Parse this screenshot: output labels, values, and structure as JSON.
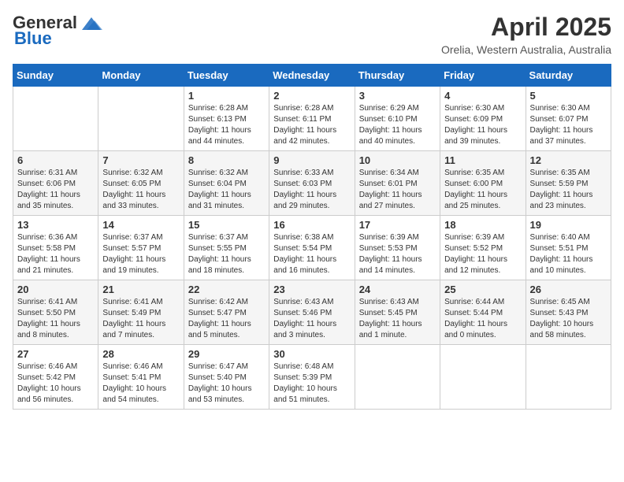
{
  "header": {
    "logo_line1": "General",
    "logo_line2": "Blue",
    "month": "April 2025",
    "location": "Orelia, Western Australia, Australia"
  },
  "days_of_week": [
    "Sunday",
    "Monday",
    "Tuesday",
    "Wednesday",
    "Thursday",
    "Friday",
    "Saturday"
  ],
  "weeks": [
    [
      {
        "day": "",
        "sunrise": "",
        "sunset": "",
        "daylight": ""
      },
      {
        "day": "",
        "sunrise": "",
        "sunset": "",
        "daylight": ""
      },
      {
        "day": "1",
        "sunrise": "Sunrise: 6:28 AM",
        "sunset": "Sunset: 6:13 PM",
        "daylight": "Daylight: 11 hours and 44 minutes."
      },
      {
        "day": "2",
        "sunrise": "Sunrise: 6:28 AM",
        "sunset": "Sunset: 6:11 PM",
        "daylight": "Daylight: 11 hours and 42 minutes."
      },
      {
        "day": "3",
        "sunrise": "Sunrise: 6:29 AM",
        "sunset": "Sunset: 6:10 PM",
        "daylight": "Daylight: 11 hours and 40 minutes."
      },
      {
        "day": "4",
        "sunrise": "Sunrise: 6:30 AM",
        "sunset": "Sunset: 6:09 PM",
        "daylight": "Daylight: 11 hours and 39 minutes."
      },
      {
        "day": "5",
        "sunrise": "Sunrise: 6:30 AM",
        "sunset": "Sunset: 6:07 PM",
        "daylight": "Daylight: 11 hours and 37 minutes."
      }
    ],
    [
      {
        "day": "6",
        "sunrise": "Sunrise: 6:31 AM",
        "sunset": "Sunset: 6:06 PM",
        "daylight": "Daylight: 11 hours and 35 minutes."
      },
      {
        "day": "7",
        "sunrise": "Sunrise: 6:32 AM",
        "sunset": "Sunset: 6:05 PM",
        "daylight": "Daylight: 11 hours and 33 minutes."
      },
      {
        "day": "8",
        "sunrise": "Sunrise: 6:32 AM",
        "sunset": "Sunset: 6:04 PM",
        "daylight": "Daylight: 11 hours and 31 minutes."
      },
      {
        "day": "9",
        "sunrise": "Sunrise: 6:33 AM",
        "sunset": "Sunset: 6:03 PM",
        "daylight": "Daylight: 11 hours and 29 minutes."
      },
      {
        "day": "10",
        "sunrise": "Sunrise: 6:34 AM",
        "sunset": "Sunset: 6:01 PM",
        "daylight": "Daylight: 11 hours and 27 minutes."
      },
      {
        "day": "11",
        "sunrise": "Sunrise: 6:35 AM",
        "sunset": "Sunset: 6:00 PM",
        "daylight": "Daylight: 11 hours and 25 minutes."
      },
      {
        "day": "12",
        "sunrise": "Sunrise: 6:35 AM",
        "sunset": "Sunset: 5:59 PM",
        "daylight": "Daylight: 11 hours and 23 minutes."
      }
    ],
    [
      {
        "day": "13",
        "sunrise": "Sunrise: 6:36 AM",
        "sunset": "Sunset: 5:58 PM",
        "daylight": "Daylight: 11 hours and 21 minutes."
      },
      {
        "day": "14",
        "sunrise": "Sunrise: 6:37 AM",
        "sunset": "Sunset: 5:57 PM",
        "daylight": "Daylight: 11 hours and 19 minutes."
      },
      {
        "day": "15",
        "sunrise": "Sunrise: 6:37 AM",
        "sunset": "Sunset: 5:55 PM",
        "daylight": "Daylight: 11 hours and 18 minutes."
      },
      {
        "day": "16",
        "sunrise": "Sunrise: 6:38 AM",
        "sunset": "Sunset: 5:54 PM",
        "daylight": "Daylight: 11 hours and 16 minutes."
      },
      {
        "day": "17",
        "sunrise": "Sunrise: 6:39 AM",
        "sunset": "Sunset: 5:53 PM",
        "daylight": "Daylight: 11 hours and 14 minutes."
      },
      {
        "day": "18",
        "sunrise": "Sunrise: 6:39 AM",
        "sunset": "Sunset: 5:52 PM",
        "daylight": "Daylight: 11 hours and 12 minutes."
      },
      {
        "day": "19",
        "sunrise": "Sunrise: 6:40 AM",
        "sunset": "Sunset: 5:51 PM",
        "daylight": "Daylight: 11 hours and 10 minutes."
      }
    ],
    [
      {
        "day": "20",
        "sunrise": "Sunrise: 6:41 AM",
        "sunset": "Sunset: 5:50 PM",
        "daylight": "Daylight: 11 hours and 8 minutes."
      },
      {
        "day": "21",
        "sunrise": "Sunrise: 6:41 AM",
        "sunset": "Sunset: 5:49 PM",
        "daylight": "Daylight: 11 hours and 7 minutes."
      },
      {
        "day": "22",
        "sunrise": "Sunrise: 6:42 AM",
        "sunset": "Sunset: 5:47 PM",
        "daylight": "Daylight: 11 hours and 5 minutes."
      },
      {
        "day": "23",
        "sunrise": "Sunrise: 6:43 AM",
        "sunset": "Sunset: 5:46 PM",
        "daylight": "Daylight: 11 hours and 3 minutes."
      },
      {
        "day": "24",
        "sunrise": "Sunrise: 6:43 AM",
        "sunset": "Sunset: 5:45 PM",
        "daylight": "Daylight: 11 hours and 1 minute."
      },
      {
        "day": "25",
        "sunrise": "Sunrise: 6:44 AM",
        "sunset": "Sunset: 5:44 PM",
        "daylight": "Daylight: 11 hours and 0 minutes."
      },
      {
        "day": "26",
        "sunrise": "Sunrise: 6:45 AM",
        "sunset": "Sunset: 5:43 PM",
        "daylight": "Daylight: 10 hours and 58 minutes."
      }
    ],
    [
      {
        "day": "27",
        "sunrise": "Sunrise: 6:46 AM",
        "sunset": "Sunset: 5:42 PM",
        "daylight": "Daylight: 10 hours and 56 minutes."
      },
      {
        "day": "28",
        "sunrise": "Sunrise: 6:46 AM",
        "sunset": "Sunset: 5:41 PM",
        "daylight": "Daylight: 10 hours and 54 minutes."
      },
      {
        "day": "29",
        "sunrise": "Sunrise: 6:47 AM",
        "sunset": "Sunset: 5:40 PM",
        "daylight": "Daylight: 10 hours and 53 minutes."
      },
      {
        "day": "30",
        "sunrise": "Sunrise: 6:48 AM",
        "sunset": "Sunset: 5:39 PM",
        "daylight": "Daylight: 10 hours and 51 minutes."
      },
      {
        "day": "",
        "sunrise": "",
        "sunset": "",
        "daylight": ""
      },
      {
        "day": "",
        "sunrise": "",
        "sunset": "",
        "daylight": ""
      },
      {
        "day": "",
        "sunrise": "",
        "sunset": "",
        "daylight": ""
      }
    ]
  ]
}
